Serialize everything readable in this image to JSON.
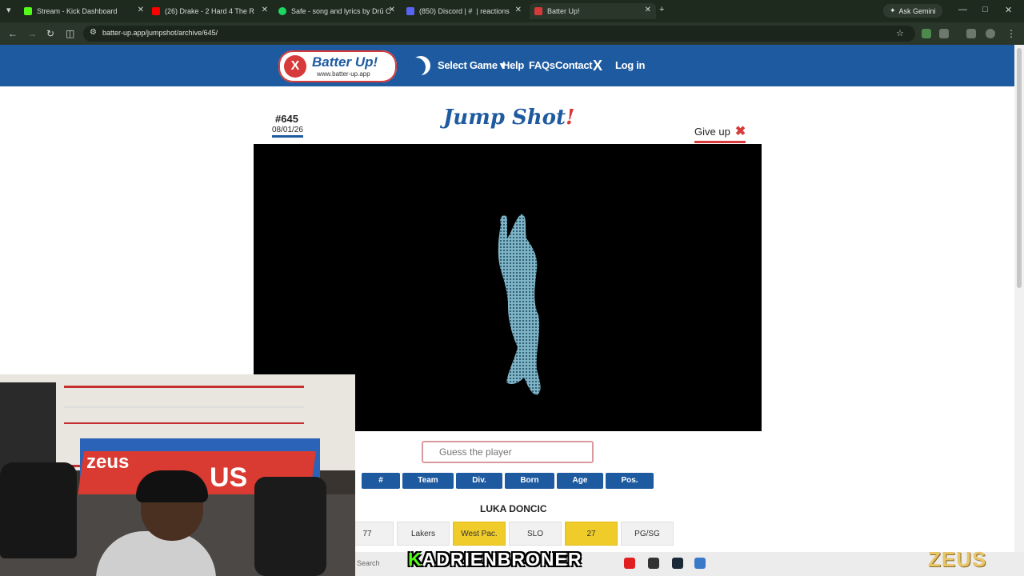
{
  "browser": {
    "tabs": [
      {
        "title": "Stream - Kick Dashboard",
        "favicon_color": "#53fc18"
      },
      {
        "title": "(26) Drake - 2 Hard 4 The R",
        "favicon_color": "#ff0000"
      },
      {
        "title": "Safe - song and lyrics by Drū C",
        "favicon_color": "#1ed760"
      },
      {
        "title": "(850) Discord | #  | reactions",
        "favicon_color": "#5865f2"
      },
      {
        "title": "Batter Up!",
        "favicon_color": "#d63a3a"
      }
    ],
    "new_tab": "+",
    "ask_gemini": "Ask Gemini",
    "url": "batter-up.app/jumpshot/archive/645/"
  },
  "site": {
    "logo_name": "Batter Up!",
    "logo_site": "www.batter-up.app",
    "logo_glyph": "X",
    "nav": {
      "select_game": "Select Game ▾",
      "help": "Help",
      "faqs": "FAQs",
      "contact": "Contact",
      "x_logo": "X",
      "login": "Log in"
    }
  },
  "game": {
    "puzzle_number": "#645",
    "puzzle_date": "08/01/26",
    "title_main": "Jump Shot",
    "title_bang": "!",
    "give_up": "Give up",
    "give_up_icon": "✖",
    "guess_placeholder": "Guess the player",
    "columns": [
      "#",
      "Team",
      "Div.",
      "Born",
      "Age",
      "Pos."
    ],
    "guess": {
      "name": "LUKA DONCIC",
      "cells": [
        {
          "value": "77",
          "correct": false
        },
        {
          "value": "Lakers",
          "correct": false
        },
        {
          "value": "West Pac.",
          "correct": true
        },
        {
          "value": "SLO",
          "correct": false
        },
        {
          "value": "27",
          "correct": true
        },
        {
          "value": "PG/SG",
          "correct": false
        }
      ]
    }
  },
  "overlay": {
    "zeus_text_1": "zeus",
    "zeus_text_2": "US",
    "streamer_k": "K",
    "streamer_name": "ADRIENBRONER",
    "search_label": "Search",
    "watermark": "ZEUS"
  },
  "colors": {
    "brand_blue": "#1e5aa0",
    "brand_red": "#d63a3a",
    "correct_yellow": "#f0cc2a",
    "kick_green": "#53fc18"
  }
}
